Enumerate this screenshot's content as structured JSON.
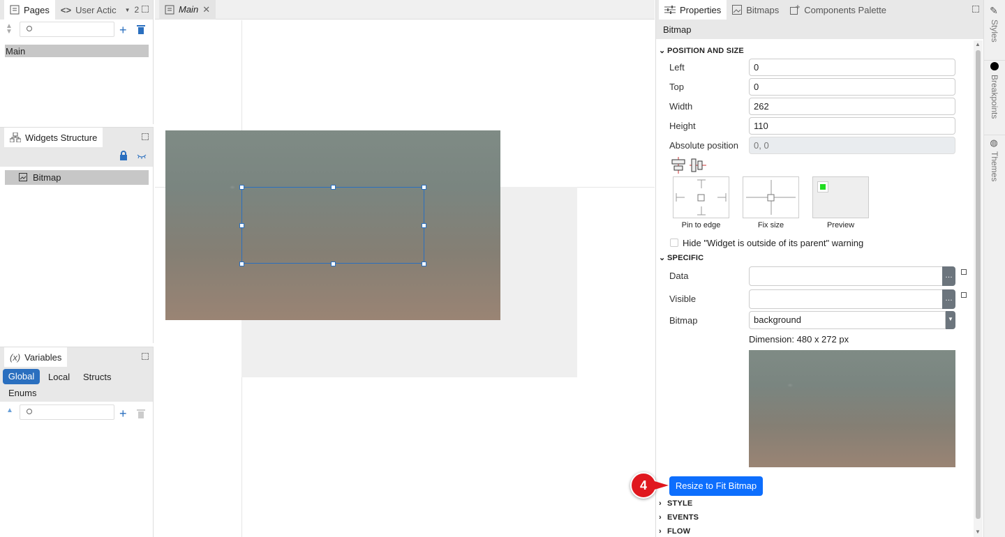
{
  "left_panel": {
    "pages_tab": "Pages",
    "user_actions_tab": "User Actic",
    "overflow_count": "2",
    "pages": [
      "Main"
    ],
    "widgets_structure_tab": "Widgets Structure",
    "widgets": [
      "Bitmap"
    ],
    "variables_tab": "Variables",
    "variable_scopes": [
      "Global",
      "Local",
      "Structs",
      "Enums"
    ]
  },
  "editor": {
    "tab_label": "Main"
  },
  "right_panel": {
    "tabs": [
      "Properties",
      "Bitmaps",
      "Components Palette"
    ],
    "title": "Bitmap",
    "position_section": "POSITION AND SIZE",
    "left_label": "Left",
    "left_value": "0",
    "top_label": "Top",
    "top_value": "0",
    "width_label": "Width",
    "width_value": "262",
    "height_label": "Height",
    "height_value": "110",
    "abs_label": "Absolute position",
    "abs_value": "0, 0",
    "pin_label": "Pin to edge",
    "fix_label": "Fix size",
    "preview_label": "Preview",
    "hide_warning_label": "Hide \"Widget is outside of its parent\" warning",
    "specific_section": "SPECIFIC",
    "data_label": "Data",
    "visible_label": "Visible",
    "bitmap_label": "Bitmap",
    "bitmap_value": "background",
    "dimension_text": "Dimension: 480 x 272 px",
    "resize_button": "Resize to Fit Bitmap",
    "step_badge": "4",
    "collapsed_sections": [
      "STYLE",
      "EVENTS",
      "FLOW"
    ]
  },
  "side_tabs": [
    "Styles",
    "Breakpoints",
    "Themes"
  ],
  "colors": {
    "accent": "#2a6fbf",
    "button": "#0d6efd",
    "badge": "#e0181f",
    "preview_green": "#22dd22"
  }
}
